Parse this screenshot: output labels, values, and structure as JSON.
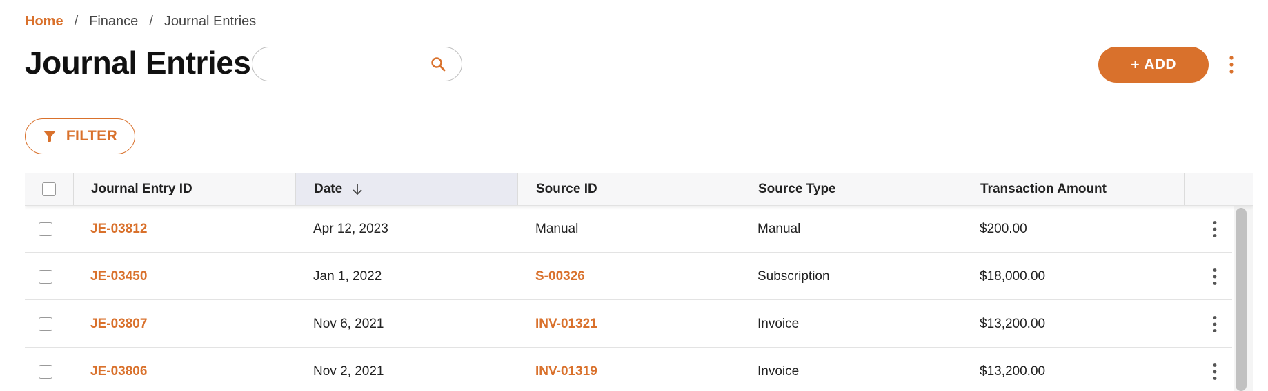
{
  "breadcrumb": {
    "home": "Home",
    "separator": "/",
    "finance": "Finance",
    "current": "Journal Entries"
  },
  "page": {
    "title": "Journal Entries"
  },
  "search": {
    "value": "",
    "placeholder": ""
  },
  "actions": {
    "add_plus": "+",
    "add_label": "ADD",
    "filter_label": "FILTER"
  },
  "colors": {
    "accent": "#d9712c",
    "sorted_header_bg": "#e9eaf2",
    "header_bg": "#f7f7f8"
  },
  "icons": {
    "search": "search-icon",
    "more": "more-vertical-icon",
    "filter": "filter-icon",
    "sort": "arrow-down-icon"
  },
  "table": {
    "columns": [
      {
        "label": "Journal Entry ID"
      },
      {
        "label": "Date",
        "sorted": "descending"
      },
      {
        "label": "Source ID"
      },
      {
        "label": "Source Type"
      },
      {
        "label": "Transaction Amount"
      }
    ],
    "rows": [
      {
        "id": "JE-03812",
        "date": "Apr 12, 2023",
        "source_id": "Manual",
        "source_id_is_link": false,
        "source_type": "Manual",
        "amount": "$200.00"
      },
      {
        "id": "JE-03450",
        "date": "Jan 1, 2022",
        "source_id": "S-00326",
        "source_id_is_link": true,
        "source_type": "Subscription",
        "amount": "$18,000.00"
      },
      {
        "id": "JE-03807",
        "date": "Nov 6, 2021",
        "source_id": "INV-01321",
        "source_id_is_link": true,
        "source_type": "Invoice",
        "amount": "$13,200.00"
      },
      {
        "id": "JE-03806",
        "date": "Nov 2, 2021",
        "source_id": "INV-01319",
        "source_id_is_link": true,
        "source_type": "Invoice",
        "amount": "$13,200.00"
      }
    ]
  }
}
